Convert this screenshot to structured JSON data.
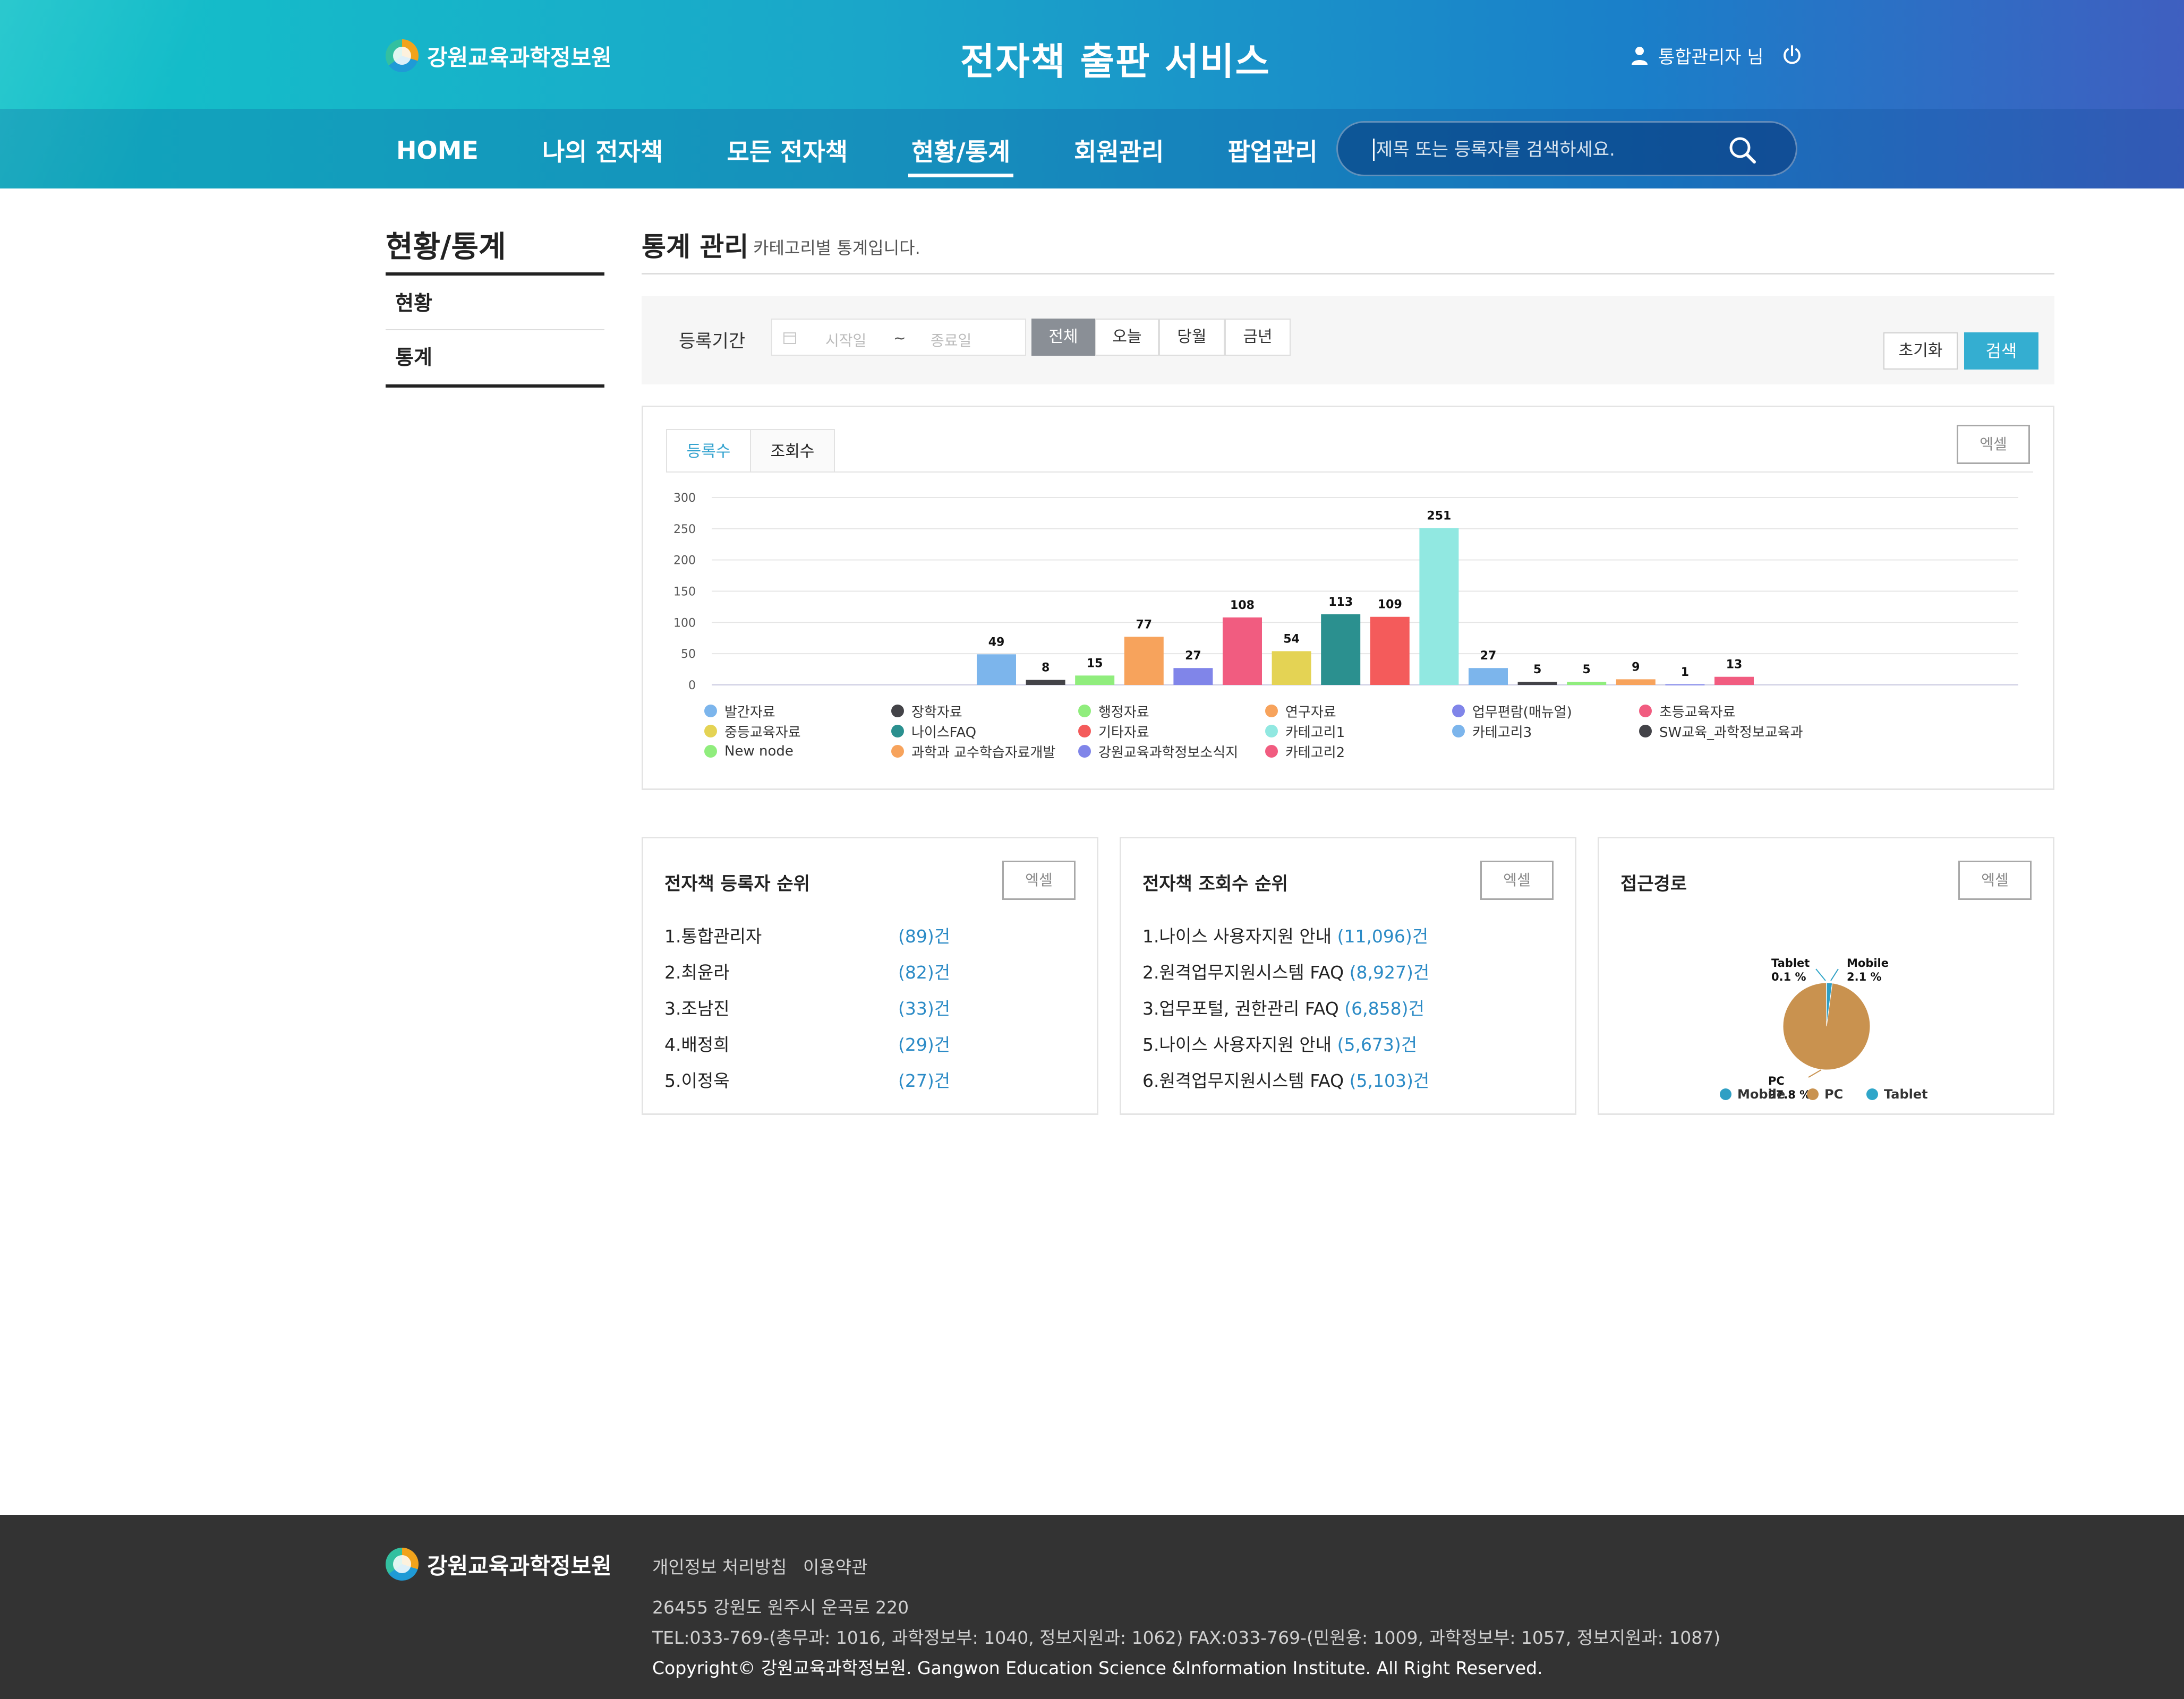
{
  "header": {
    "logo_text": "강원교육과학정보원",
    "site_title": "전자책 출판 서비스",
    "user_label": "통합관리자 님",
    "nav": [
      {
        "label": "HOME"
      },
      {
        "label": "나의 전자책"
      },
      {
        "label": "모든 전자책"
      },
      {
        "label": "현황/통계"
      },
      {
        "label": "회원관리"
      },
      {
        "label": "팝업관리"
      }
    ],
    "active_nav": "현황/통계",
    "search_placeholder": "제목 또는 등록자를 검색하세요."
  },
  "sidebar": {
    "title": "현황/통계",
    "items": [
      {
        "label": "현황"
      },
      {
        "label": "통계"
      }
    ],
    "active_item": "통계"
  },
  "main": {
    "title": "통계 관리",
    "description": "카테고리별 통계입니다.",
    "filter": {
      "label": "등록기간",
      "start_placeholder": "시작일",
      "separator": "~",
      "end_placeholder": "종료일",
      "segments": [
        "전체",
        "오늘",
        "당월",
        "금년"
      ],
      "active_segment": "전체",
      "reset_label": "초기화",
      "search_label": "검색"
    },
    "chart_panel": {
      "tabs": [
        "등록수",
        "조회수"
      ],
      "active_tab": "등록수",
      "excel_label": "엑셀"
    }
  },
  "chart_data": [
    {
      "type": "bar",
      "title": "",
      "xlabel": "",
      "ylabel": "",
      "ylim": [
        0,
        300
      ],
      "yticks": [
        0,
        50,
        100,
        150,
        200,
        250,
        300
      ],
      "grid": true,
      "legend": "bottom",
      "categories": [
        "발간자료",
        "장학자료",
        "행정자료",
        "연구자료",
        "업무편람(매뉴얼)",
        "초등교육자료",
        "중등교육자료",
        "나이스FAQ",
        "기타자료",
        "카테고리1",
        "카테고리3",
        "SW교육_과학정보교육과",
        "New node",
        "과학과 교수학습자료개발",
        "강원교육과학정보소식지",
        "카테고리2"
      ],
      "colors": [
        "#7cb5ec",
        "#434348",
        "#90ed7d",
        "#f7a35c",
        "#8085e9",
        "#f15c80",
        "#e4d354",
        "#2b908f",
        "#f45b5b",
        "#91e8e1",
        "#7cb5ec",
        "#434348",
        "#90ed7d",
        "#f7a35c",
        "#8085e9",
        "#f15c80"
      ],
      "values": [
        49,
        8,
        15,
        77,
        27,
        108,
        54,
        113,
        109,
        251,
        27,
        5,
        5,
        9,
        1,
        13
      ]
    },
    {
      "type": "pie",
      "title": "",
      "legend": "bottom",
      "slices": [
        {
          "name": "Mobile",
          "value": 2.1,
          "label": "Mobile",
          "pct": "2.1 %",
          "color": "#2f9fc4"
        },
        {
          "name": "PC",
          "value": 97.8,
          "label": "PC",
          "pct": "97.8 %",
          "color": "#c9924f"
        },
        {
          "name": "Tablet",
          "value": 0.1,
          "label": "Tablet",
          "pct": "0.1 %",
          "color": "#2fa6c9"
        }
      ]
    }
  ],
  "panels": {
    "registrant_rank": {
      "title": "전자책 등록자 순위",
      "excel_label": "엑셀",
      "rows": [
        {
          "name": "1.통합관리자",
          "count": "(89)건"
        },
        {
          "name": "2.최윤라",
          "count": "(82)건"
        },
        {
          "name": "3.조남진",
          "count": "(33)건"
        },
        {
          "name": "4.배정희",
          "count": "(29)건"
        },
        {
          "name": "5.이정욱",
          "count": "(27)건"
        }
      ]
    },
    "view_rank": {
      "title": "전자책 조회수 순위",
      "excel_label": "엑셀",
      "rows": [
        {
          "name": "1.나이스 사용자지원 안내",
          "count": "(11,096)건"
        },
        {
          "name": "2.원격업무지원시스템 FAQ",
          "count": "(8,927)건"
        },
        {
          "name": "3.업무포털, 권한관리 FAQ",
          "count": "(6,858)건"
        },
        {
          "name": "5.나이스 사용자지원 안내",
          "count": "(5,673)건"
        },
        {
          "name": "6.원격업무지원시스템 FAQ",
          "count": "(5,103)건"
        }
      ]
    },
    "access_path": {
      "title": "접근경로",
      "excel_label": "엑셀"
    }
  },
  "footer": {
    "logo_text": "강원교육과학정보원",
    "links": [
      "개인정보 처리방침",
      "이용약관"
    ],
    "address": "26455 강원도 원주시 운곡로 220",
    "tel": "TEL:033-769-(총무과: 1016, 과학정보부: 1040, 정보지원과: 1062) FAX:033-769-(민원용: 1009, 과학정보부: 1057, 정보지원과: 1087)",
    "copyright": "Copyright© 강원교육과학정보원. Gangwon Education Science &Information Institute. All Right Reserved."
  }
}
